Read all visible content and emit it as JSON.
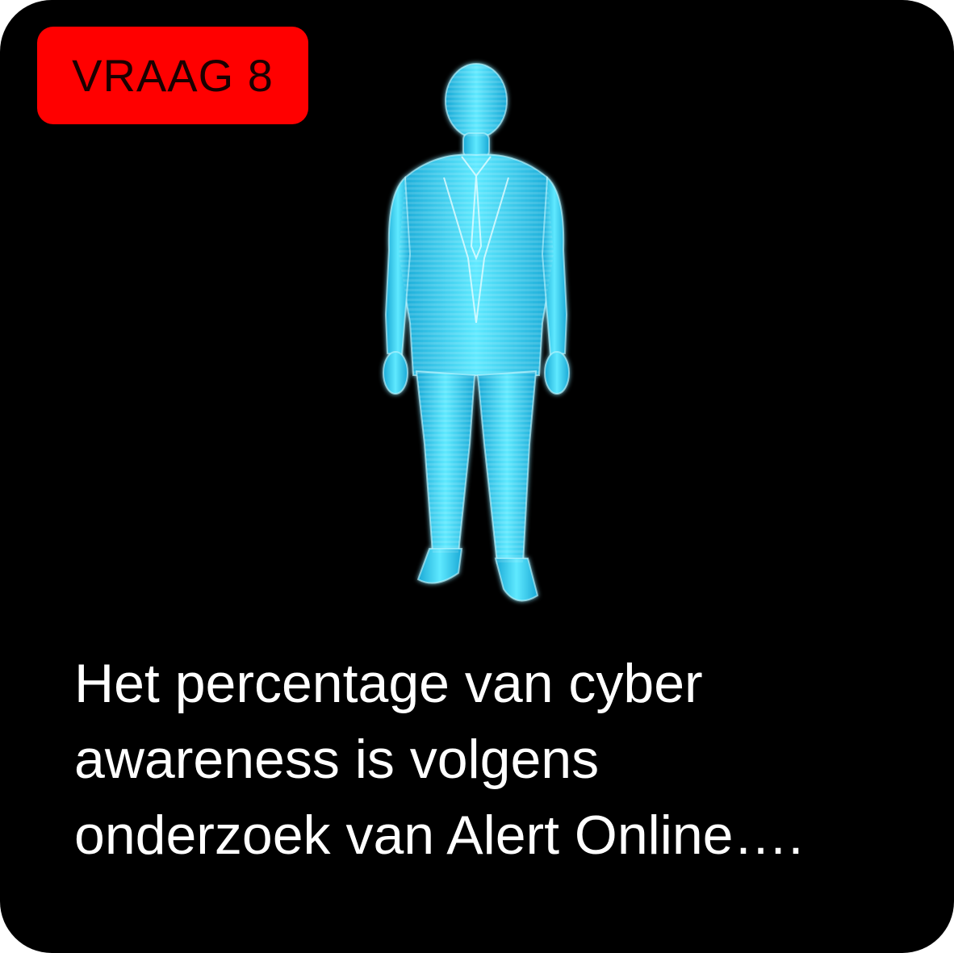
{
  "badge": {
    "label": "VRAAG 8",
    "color": "#ff0000"
  },
  "illustration": {
    "icon": "hologram-man-icon",
    "color": "#38d8f4"
  },
  "question": {
    "lines": [
      "Het percentage van cyber",
      "awareness is volgens",
      "onderzoek van Alert Online…."
    ]
  }
}
